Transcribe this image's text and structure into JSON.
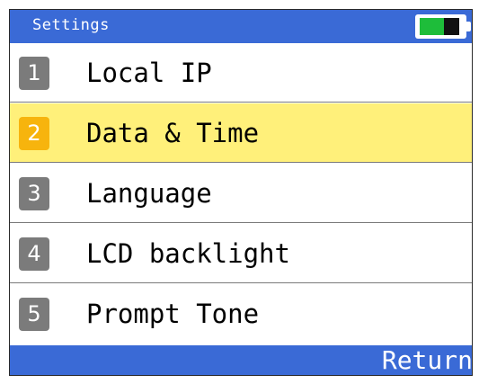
{
  "header": {
    "title": "Settings",
    "battery_icon": "battery-icon",
    "battery_level": 0.6,
    "colors": {
      "bar": "#3a6ad6",
      "battery_charge": "#1ebd3a"
    }
  },
  "menu": {
    "items": [
      {
        "number": "1",
        "label": "Local IP",
        "selected": false
      },
      {
        "number": "2",
        "label": "Data & Time",
        "selected": true
      },
      {
        "number": "3",
        "label": "Language",
        "selected": false
      },
      {
        "number": "4",
        "label": "LCD backlight",
        "selected": false
      },
      {
        "number": "5",
        "label": "Prompt Tone",
        "selected": false
      }
    ],
    "colors": {
      "selected_row": "#fff07a",
      "selected_badge": "#f7b40d",
      "badge": "#7b7b7b"
    }
  },
  "footer": {
    "return_label": "Return"
  }
}
